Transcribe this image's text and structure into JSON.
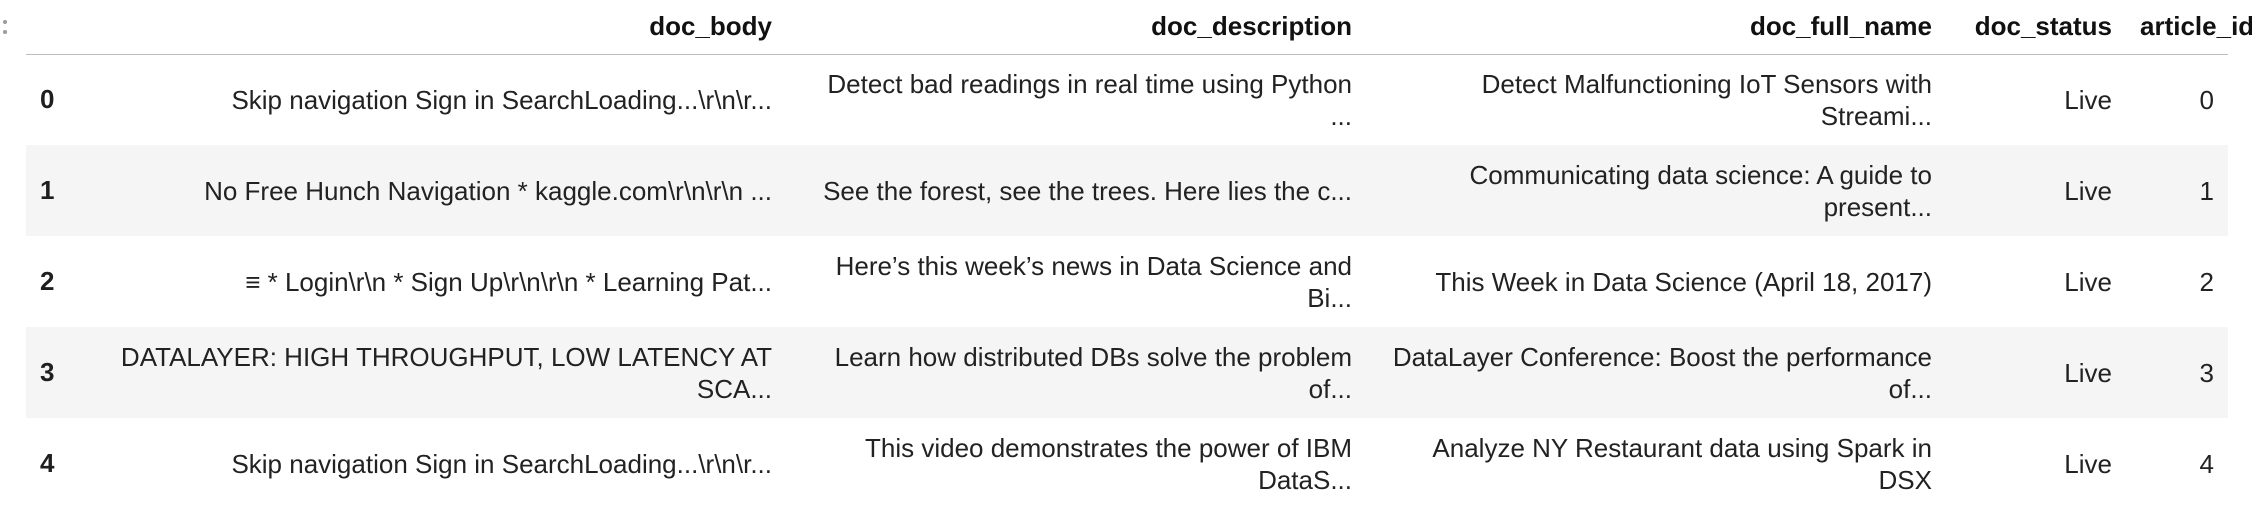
{
  "table": {
    "columns": [
      "",
      "doc_body",
      "doc_description",
      "doc_full_name",
      "doc_status",
      "article_id"
    ],
    "rows": [
      {
        "index": "0",
        "doc_body": "Skip navigation Sign in SearchLoading...\\r\\n\\r...",
        "doc_description": "Detect bad readings in real time using Python ...",
        "doc_full_name": "Detect Malfunctioning IoT Sensors with Streami...",
        "doc_status": "Live",
        "article_id": "0"
      },
      {
        "index": "1",
        "doc_body": "No Free Hunch Navigation * kaggle.com\\r\\n\\r\\n ...",
        "doc_description": "See the forest, see the trees. Here lies the c...",
        "doc_full_name": "Communicating data science: A guide to present...",
        "doc_status": "Live",
        "article_id": "1"
      },
      {
        "index": "2",
        "doc_body": "≡ * Login\\r\\n * Sign Up\\r\\n\\r\\n * Learning Pat...",
        "doc_description": "Here’s this week’s news in Data Science and Bi...",
        "doc_full_name": "This Week in Data Science (April 18, 2017)",
        "doc_status": "Live",
        "article_id": "2"
      },
      {
        "index": "3",
        "doc_body": "DATALAYER: HIGH THROUGHPUT, LOW LATENCY AT SCA...",
        "doc_description": "Learn how distributed DBs solve the problem of...",
        "doc_full_name": "DataLayer Conference: Boost the performance of...",
        "doc_status": "Live",
        "article_id": "3"
      },
      {
        "index": "4",
        "doc_body": "Skip navigation Sign in SearchLoading...\\r\\n\\r...",
        "doc_description": "This video demonstrates the power of IBM DataS...",
        "doc_full_name": "Analyze NY Restaurant data using Spark in DSX",
        "doc_status": "Live",
        "article_id": "4"
      }
    ]
  },
  "colors": {
    "stripe": "#f5f5f5",
    "header_border": "#bdbdbd",
    "text": "#222222"
  },
  "icons": {
    "gutter": "drag-handle-icon"
  }
}
